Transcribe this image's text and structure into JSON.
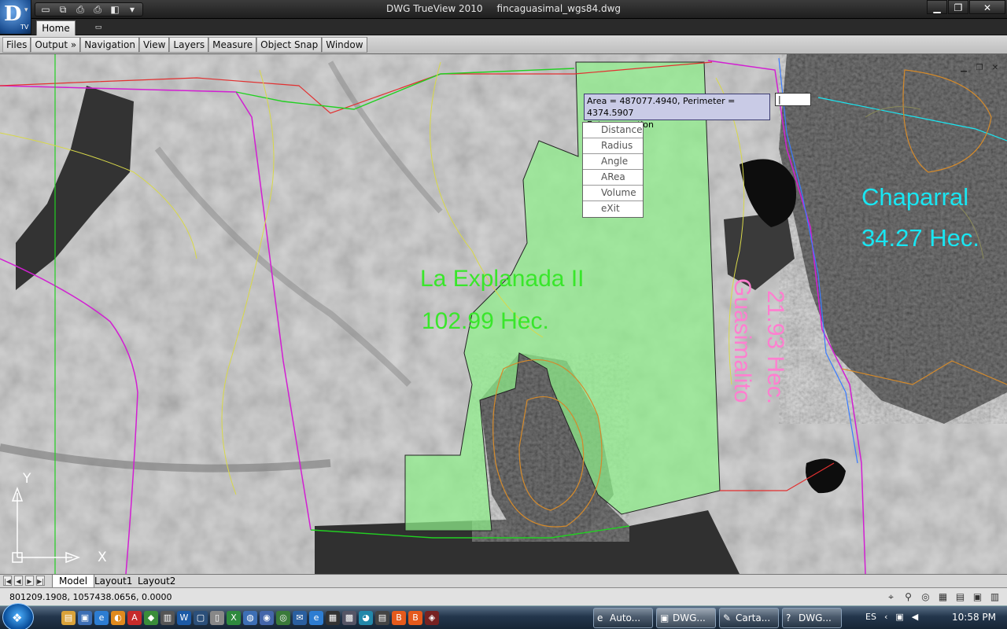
{
  "titlebar": {
    "app_name": "DWG TrueView 2010",
    "file_name": "fincaguasimal_wgs84.dwg",
    "app_logo_text": "D",
    "app_logo_sub": "TV",
    "quick_access_icons": [
      "open-folder-icon",
      "publish-icon",
      "print-icon",
      "plot-icon",
      "view-icon",
      "dropdown-icon"
    ],
    "window_controls": {
      "minimize": "▁",
      "restore": "❐",
      "close": "✕"
    }
  },
  "ribbon": {
    "tabs": [
      {
        "label": "Home"
      }
    ],
    "panels": [
      "Files",
      "Output",
      "»",
      "Navigation",
      "View",
      "Layers",
      "Measure",
      "Object Snap",
      "Window"
    ]
  },
  "drawing": {
    "measure_tooltip": {
      "result": "Area = 487077.4940, Perimeter = 4374.5907",
      "prompt": "Enter an option"
    },
    "dynamic_input_value": "",
    "options_menu": [
      "Distance",
      "Radius",
      "Angle",
      "ARea",
      "Volume",
      "eXit"
    ],
    "parcels": [
      {
        "name": "La Explanada II",
        "area": "102.99 Hec.",
        "color": "#39e62b"
      },
      {
        "name": "Chaparral",
        "area": "34.27 Hec.",
        "color": "#19e6f2"
      },
      {
        "name": "Guasimalito",
        "area": "21.93 Hec.",
        "color": "#ff7fd0"
      }
    ],
    "ucs": {
      "y": "Y",
      "x": "X"
    },
    "viewport_controls": [
      "▁",
      "❐",
      "✕"
    ]
  },
  "layout_tabs": {
    "nav_arrows": [
      "|◀",
      "◀",
      "▶",
      "▶|"
    ],
    "tabs": [
      "Model",
      "Layout1",
      "Layout2"
    ],
    "active": "Model"
  },
  "statusbar": {
    "coordinates": "801209.1908, 1057438.0656, 0.0000",
    "icons": [
      "snap-icon",
      "zoom-icon",
      "steering-wheel-icon",
      "showmotion-icon",
      "grid-icon",
      "workspace-icon",
      "lock-icon"
    ]
  },
  "taskbar": {
    "start_glyph": "❖",
    "tasks": [
      {
        "icon": "e",
        "label": "Auto..."
      },
      {
        "icon": "▣",
        "label": "DWG..."
      },
      {
        "icon": "✎",
        "label": "Carta..."
      },
      {
        "icon": "?",
        "label": "DWG..."
      }
    ],
    "language": "ES",
    "clock": "10:58 PM"
  },
  "colors": {
    "parcel_fill": "#8ff08a",
    "selection_tooltip_bg": "#c9cbe6",
    "boundary_magenta": "#d21fd2",
    "boundary_yellow": "#d8d84a",
    "contour_orange": "#d48a2b"
  }
}
